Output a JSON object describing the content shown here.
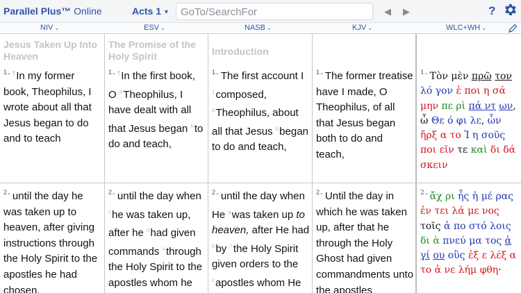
{
  "app": {
    "title_bold": "Parallel Plus",
    "title_tm": "™",
    "title_rest": " Online",
    "book_ref": "Acts 1",
    "search_placeholder": "GoTo/SearchFor",
    "help": "?"
  },
  "versions": [
    {
      "label": "NIV"
    },
    {
      "label": "ESV"
    },
    {
      "label": "NASB"
    },
    {
      "label": "KJV"
    },
    {
      "label": "WLC+WH"
    }
  ],
  "columns": {
    "niv": {
      "heading": "Jesus Taken Up Into Heaven",
      "v1_num": "1",
      "v1_text": "In my former book, Theophilus, I wrote about all that Jesus began to do and to teach",
      "v2_num": "2",
      "v2_text": "until the day he was taken up to heaven, after giving instructions through the Holy Spirit to the apostles he had chosen."
    },
    "esv": {
      "heading": "The Promise of the Holy Spirit",
      "v1_num": "1",
      "v1_a": "In the first book, O ",
      "v1_b": "Theophilus, I have dealt with all that Jesus began ",
      "v1_c": "to do and teach,",
      "fn_a": "a",
      "fn_b": "b",
      "v2_num": "2",
      "v2_a": "until the day when ",
      "v2_b": "he was taken up, after he ",
      "v2_c": "had given commands ",
      "v2_d": "through the Holy Spirit to the apostles whom he had chosen.",
      "fn_c": "c",
      "fn_d": "d",
      "fn_e": "e"
    },
    "nasb": {
      "heading": "Introduction",
      "v1_num": "1",
      "v1_a": "The first account I ",
      "v1_b": "composed, ",
      "v1_c": "Theophilus, about all that Jesus ",
      "v1_d": "began to do and teach,",
      "fn_a": "1",
      "fn_b": "a",
      "fn_c": "b",
      "v2_num": "2",
      "v2_a": "until the day when He ",
      "v2_b": "was taken up ",
      "v2_italic": "to heaven,",
      "v2_c": " after He had ",
      "v2_d": "by ",
      "v2_e": "the Holy Spirit given orders to the ",
      "v2_f": "apostles whom He had",
      "fn_d": "a",
      "fn_e": "b",
      "fn_f": "c"
    },
    "kjv": {
      "v1_num": "1",
      "v1_text": "The former treatise have I made, O Theophilus, of all that Jesus began both to do and teach,",
      "v2_num": "2",
      "v2_text": "Until the day in which he was taken up, after that he through the Holy Ghost had given commandments unto the apostles"
    },
    "wh": {
      "v1_num": "1",
      "v1": [
        {
          "t": "Τὸν μὲν ",
          "c": "k"
        },
        {
          "t": "πρῶ",
          "c": "k u"
        },
        {
          "t": " ",
          "c": "k"
        },
        {
          "t": "τον",
          "c": "k u"
        },
        {
          "t": " λό γον ",
          "c": "b"
        },
        {
          "t": "ἐ ποι η σά μην",
          "c": "r"
        },
        {
          "t": " πε ρὶ ",
          "c": "g"
        },
        {
          "t": "πά ντ",
          "c": "b u"
        },
        {
          "t": " ",
          "c": "k"
        },
        {
          "t": "ων",
          "c": "b u"
        },
        {
          "t": ", ὦ",
          "c": "k"
        },
        {
          "t": " Θε ό φι λε",
          "c": "b"
        },
        {
          "t": ", ",
          "c": "k"
        },
        {
          "t": "ὧν",
          "c": "b"
        },
        {
          "t": " ἤρξ α το ",
          "c": "r"
        },
        {
          "t": "Ἰ η σοῦς",
          "c": "b"
        },
        {
          "t": " ποι εῖν ",
          "c": "r"
        },
        {
          "t": "τε ",
          "c": "k"
        },
        {
          "t": "καὶ",
          "c": "g"
        },
        {
          "t": " δι δά σκειν",
          "c": "r"
        }
      ],
      "v2_num": "2",
      "v2": [
        {
          "t": "ἄχ ρι ",
          "c": "g"
        },
        {
          "t": "ἧς ἡ μέ ρας",
          "c": "b"
        },
        {
          "t": " ἐν τει λά με νος ",
          "c": "r"
        },
        {
          "t": "τοῖς",
          "c": "k"
        },
        {
          "t": " ἀ πο στό λοις ",
          "c": "b"
        },
        {
          "t": "δι ὰ",
          "c": "g"
        },
        {
          "t": " πνεύ μα τος ",
          "c": "b"
        },
        {
          "t": "ἁ",
          "c": "b u"
        },
        {
          "t": " ",
          "c": "k"
        },
        {
          "t": "γί",
          "c": "b u"
        },
        {
          "t": " ",
          "c": "k"
        },
        {
          "t": "ου",
          "c": "b u"
        },
        {
          "t": " οὓς ",
          "c": "b"
        },
        {
          "t": "ἐξ ε λέξ α το",
          "c": "r"
        },
        {
          "t": " ἀ νε λήμ φθη",
          "c": "r"
        },
        {
          "t": "·",
          "c": "k"
        }
      ]
    }
  },
  "colors": {
    "accent": "#2c56a6",
    "greek_red": "#d0141d",
    "greek_green": "#1f8a1f",
    "greek_blue": "#1f34b4",
    "heading_gray": "#c4c4c4"
  }
}
